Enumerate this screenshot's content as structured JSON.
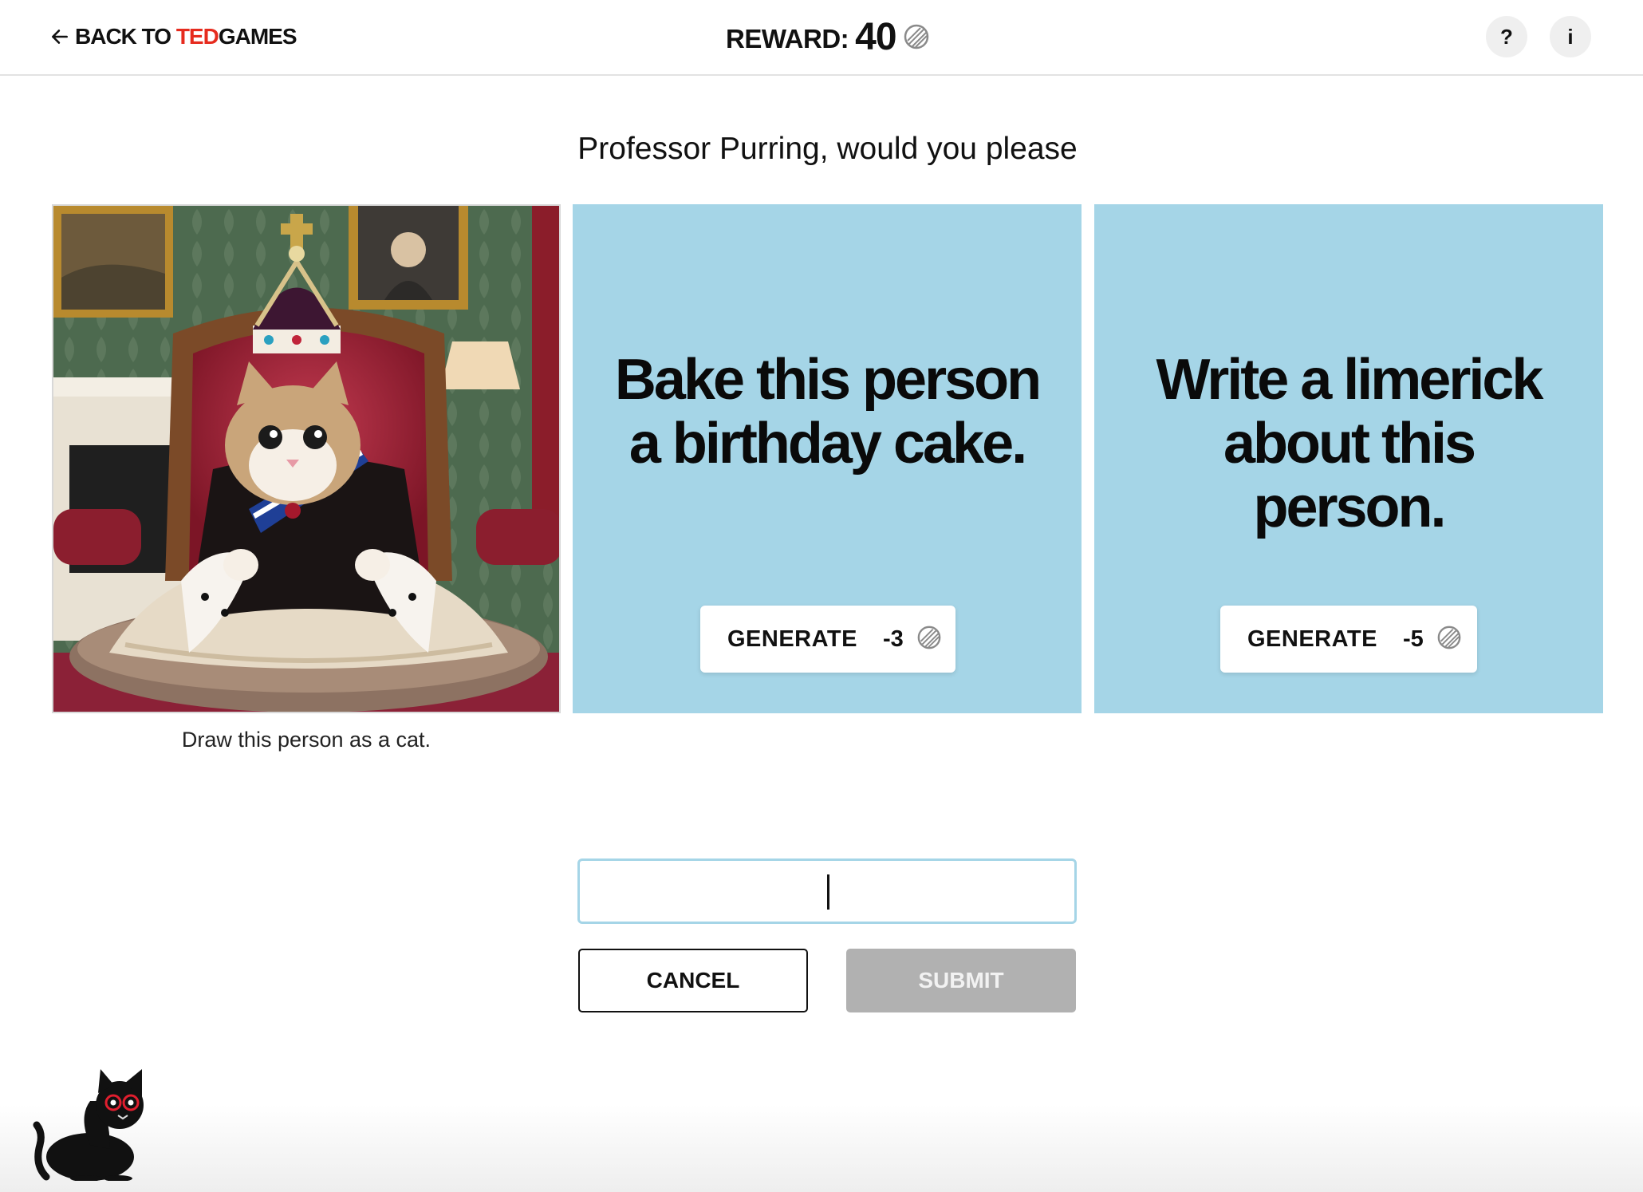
{
  "header": {
    "back_prefix": "BACK TO ",
    "back_ted": "TED",
    "back_games": "GAMES",
    "reward_label": "REWARD:",
    "reward_value": "40",
    "help_label": "?",
    "info_label": "i"
  },
  "prompt_title": "Professor Purring, would you please",
  "cards": [
    {
      "type": "image",
      "caption": "Draw this person as a cat."
    },
    {
      "type": "task",
      "text": "Bake this person a birthday cake.",
      "button_label": "GENERATE",
      "cost": "-3"
    },
    {
      "type": "task",
      "text": "Write a limerick about this person.",
      "button_label": "GENERATE",
      "cost": "-5"
    }
  ],
  "answer_input": {
    "value": "",
    "placeholder": ""
  },
  "cancel_label": "CANCEL",
  "submit_label": "SUBMIT",
  "colors": {
    "card_blue": "#a5d5e7",
    "ted_red": "#e62b1e",
    "submit_disabled": "#b1b1b1"
  },
  "icons": [
    "back-arrow-icon",
    "yarn-ball-icon",
    "help-icon",
    "info-icon",
    "cat-mascot-icon"
  ]
}
